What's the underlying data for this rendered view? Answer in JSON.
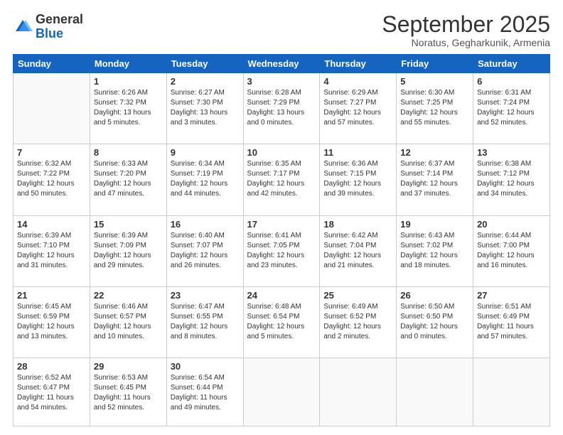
{
  "header": {
    "logo": {
      "line1": "General",
      "line2": "Blue"
    },
    "title": "September 2025",
    "location": "Noratus, Gegharkunik, Armenia"
  },
  "days_of_week": [
    "Sunday",
    "Monday",
    "Tuesday",
    "Wednesday",
    "Thursday",
    "Friday",
    "Saturday"
  ],
  "weeks": [
    [
      {
        "day": "",
        "detail": ""
      },
      {
        "day": "1",
        "detail": "Sunrise: 6:26 AM\nSunset: 7:32 PM\nDaylight: 13 hours\nand 5 minutes."
      },
      {
        "day": "2",
        "detail": "Sunrise: 6:27 AM\nSunset: 7:30 PM\nDaylight: 13 hours\nand 3 minutes."
      },
      {
        "day": "3",
        "detail": "Sunrise: 6:28 AM\nSunset: 7:29 PM\nDaylight: 13 hours\nand 0 minutes."
      },
      {
        "day": "4",
        "detail": "Sunrise: 6:29 AM\nSunset: 7:27 PM\nDaylight: 12 hours\nand 57 minutes."
      },
      {
        "day": "5",
        "detail": "Sunrise: 6:30 AM\nSunset: 7:25 PM\nDaylight: 12 hours\nand 55 minutes."
      },
      {
        "day": "6",
        "detail": "Sunrise: 6:31 AM\nSunset: 7:24 PM\nDaylight: 12 hours\nand 52 minutes."
      }
    ],
    [
      {
        "day": "7",
        "detail": "Sunrise: 6:32 AM\nSunset: 7:22 PM\nDaylight: 12 hours\nand 50 minutes."
      },
      {
        "day": "8",
        "detail": "Sunrise: 6:33 AM\nSunset: 7:20 PM\nDaylight: 12 hours\nand 47 minutes."
      },
      {
        "day": "9",
        "detail": "Sunrise: 6:34 AM\nSunset: 7:19 PM\nDaylight: 12 hours\nand 44 minutes."
      },
      {
        "day": "10",
        "detail": "Sunrise: 6:35 AM\nSunset: 7:17 PM\nDaylight: 12 hours\nand 42 minutes."
      },
      {
        "day": "11",
        "detail": "Sunrise: 6:36 AM\nSunset: 7:15 PM\nDaylight: 12 hours\nand 39 minutes."
      },
      {
        "day": "12",
        "detail": "Sunrise: 6:37 AM\nSunset: 7:14 PM\nDaylight: 12 hours\nand 37 minutes."
      },
      {
        "day": "13",
        "detail": "Sunrise: 6:38 AM\nSunset: 7:12 PM\nDaylight: 12 hours\nand 34 minutes."
      }
    ],
    [
      {
        "day": "14",
        "detail": "Sunrise: 6:39 AM\nSunset: 7:10 PM\nDaylight: 12 hours\nand 31 minutes."
      },
      {
        "day": "15",
        "detail": "Sunrise: 6:39 AM\nSunset: 7:09 PM\nDaylight: 12 hours\nand 29 minutes."
      },
      {
        "day": "16",
        "detail": "Sunrise: 6:40 AM\nSunset: 7:07 PM\nDaylight: 12 hours\nand 26 minutes."
      },
      {
        "day": "17",
        "detail": "Sunrise: 6:41 AM\nSunset: 7:05 PM\nDaylight: 12 hours\nand 23 minutes."
      },
      {
        "day": "18",
        "detail": "Sunrise: 6:42 AM\nSunset: 7:04 PM\nDaylight: 12 hours\nand 21 minutes."
      },
      {
        "day": "19",
        "detail": "Sunrise: 6:43 AM\nSunset: 7:02 PM\nDaylight: 12 hours\nand 18 minutes."
      },
      {
        "day": "20",
        "detail": "Sunrise: 6:44 AM\nSunset: 7:00 PM\nDaylight: 12 hours\nand 16 minutes."
      }
    ],
    [
      {
        "day": "21",
        "detail": "Sunrise: 6:45 AM\nSunset: 6:59 PM\nDaylight: 12 hours\nand 13 minutes."
      },
      {
        "day": "22",
        "detail": "Sunrise: 6:46 AM\nSunset: 6:57 PM\nDaylight: 12 hours\nand 10 minutes."
      },
      {
        "day": "23",
        "detail": "Sunrise: 6:47 AM\nSunset: 6:55 PM\nDaylight: 12 hours\nand 8 minutes."
      },
      {
        "day": "24",
        "detail": "Sunrise: 6:48 AM\nSunset: 6:54 PM\nDaylight: 12 hours\nand 5 minutes."
      },
      {
        "day": "25",
        "detail": "Sunrise: 6:49 AM\nSunset: 6:52 PM\nDaylight: 12 hours\nand 2 minutes."
      },
      {
        "day": "26",
        "detail": "Sunrise: 6:50 AM\nSunset: 6:50 PM\nDaylight: 12 hours\nand 0 minutes."
      },
      {
        "day": "27",
        "detail": "Sunrise: 6:51 AM\nSunset: 6:49 PM\nDaylight: 11 hours\nand 57 minutes."
      }
    ],
    [
      {
        "day": "28",
        "detail": "Sunrise: 6:52 AM\nSunset: 6:47 PM\nDaylight: 11 hours\nand 54 minutes."
      },
      {
        "day": "29",
        "detail": "Sunrise: 6:53 AM\nSunset: 6:45 PM\nDaylight: 11 hours\nand 52 minutes."
      },
      {
        "day": "30",
        "detail": "Sunrise: 6:54 AM\nSunset: 6:44 PM\nDaylight: 11 hours\nand 49 minutes."
      },
      {
        "day": "",
        "detail": ""
      },
      {
        "day": "",
        "detail": ""
      },
      {
        "day": "",
        "detail": ""
      },
      {
        "day": "",
        "detail": ""
      }
    ]
  ]
}
